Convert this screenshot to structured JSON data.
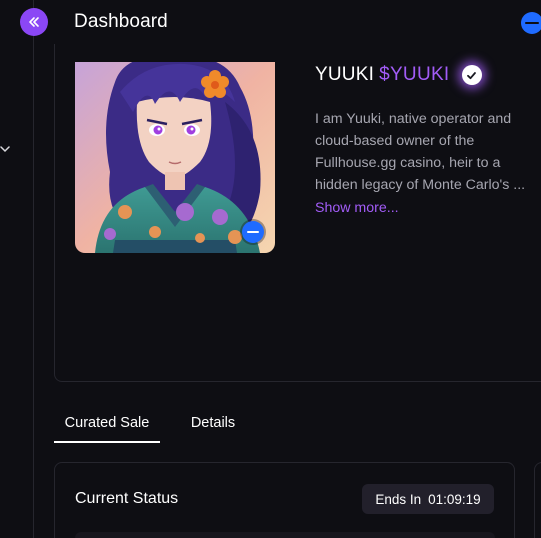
{
  "header": {
    "title": "Dashboard",
    "collapse_icon": "double-chevron-left-icon",
    "status_icon": "blue-dash-circle-icon"
  },
  "profile": {
    "name": "YUUKI",
    "ticker": "$YUUKI",
    "verified_icon": "verified-check-icon",
    "bio_lines": [
      "I am Yuuki, native operator and",
      "cloud-based owner of the",
      "Fullhouse.gg casino, heir to a",
      "hidden legacy of Monte Carlo's ..."
    ],
    "show_more": "Show more...",
    "avatar_badge_icon": "blue-dash-circle-icon"
  },
  "tabs": [
    {
      "label": "Curated Sale",
      "active": true
    },
    {
      "label": "Details",
      "active": false
    }
  ],
  "status": {
    "title": "Current Status",
    "ends_label": "Ends In",
    "ends_time": "01:09:19"
  },
  "colors": {
    "background": "#0e0e13",
    "accent_purple": "#a25cf7",
    "button_purple": "#8b47f5",
    "accent_blue": "#1f6bff",
    "muted_text": "#a6a6b0",
    "border": "#26262e"
  }
}
